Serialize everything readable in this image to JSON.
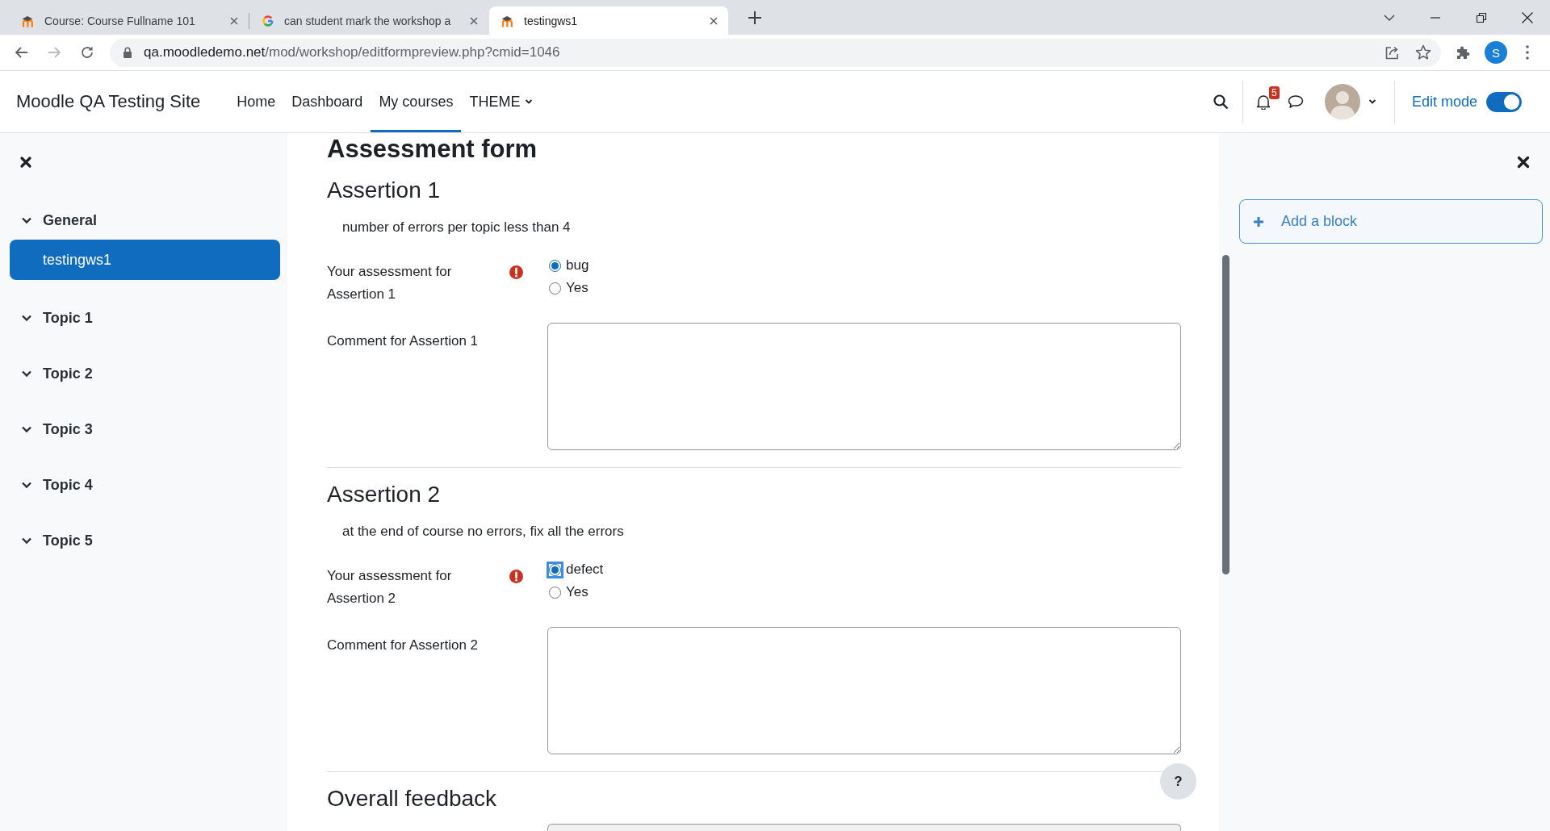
{
  "browser": {
    "tabs": [
      {
        "kind": "moodle",
        "title": "Course: Course Fullname 101",
        "selected": false
      },
      {
        "kind": "google",
        "title": "can student mark the workshop a",
        "selected": false
      },
      {
        "kind": "moodle",
        "title": "testingws1",
        "selected": true
      }
    ],
    "url_host": "qa.moodledemo.net",
    "url_path": "/mod/workshop/editformpreview.php?cmid=1046",
    "profile_initial": "S"
  },
  "navbar": {
    "site_name": "Moodle QA Testing Site",
    "items": [
      {
        "label": "Home",
        "selected": false,
        "dropdown": false
      },
      {
        "label": "Dashboard",
        "selected": false,
        "dropdown": false
      },
      {
        "label": "My courses",
        "selected": true,
        "dropdown": false
      },
      {
        "label": "THEME",
        "selected": false,
        "dropdown": true
      }
    ],
    "notification_count": "5",
    "edit_mode": {
      "label": "Edit mode",
      "on": true
    }
  },
  "course_index": {
    "sections": [
      {
        "title": "General",
        "expanded": true,
        "children": [
          {
            "title": "testingws1",
            "selected": true
          }
        ]
      },
      {
        "title": "Topic 1",
        "expanded": true
      },
      {
        "title": "Topic 2",
        "expanded": true
      },
      {
        "title": "Topic 3",
        "expanded": true
      },
      {
        "title": "Topic 4",
        "expanded": true
      },
      {
        "title": "Topic 5",
        "expanded": true
      }
    ]
  },
  "main": {
    "title": "Assessment form",
    "assertions": [
      {
        "heading": "Assertion 1",
        "description": "number of errors per topic less than 4",
        "assessment_label": "Your assessment for Assertion 1",
        "required": true,
        "options": [
          {
            "label": "bug",
            "selected": true,
            "focused": false
          },
          {
            "label": "Yes",
            "selected": false,
            "focused": false
          }
        ],
        "comment_label": "Comment for Assertion 1"
      },
      {
        "heading": "Assertion 2",
        "description": "at the end of course no errors, fix all the errors",
        "assessment_label": "Your assessment for Assertion 2",
        "required": true,
        "options": [
          {
            "label": "defect",
            "selected": true,
            "focused": true
          },
          {
            "label": "Yes",
            "selected": false,
            "focused": false
          }
        ],
        "comment_label": "Comment for Assertion 2"
      }
    ],
    "overall_feedback": {
      "heading": "Overall feedback"
    },
    "help_button": "?"
  },
  "block_drawer": {
    "add_block": "Add a block"
  }
}
